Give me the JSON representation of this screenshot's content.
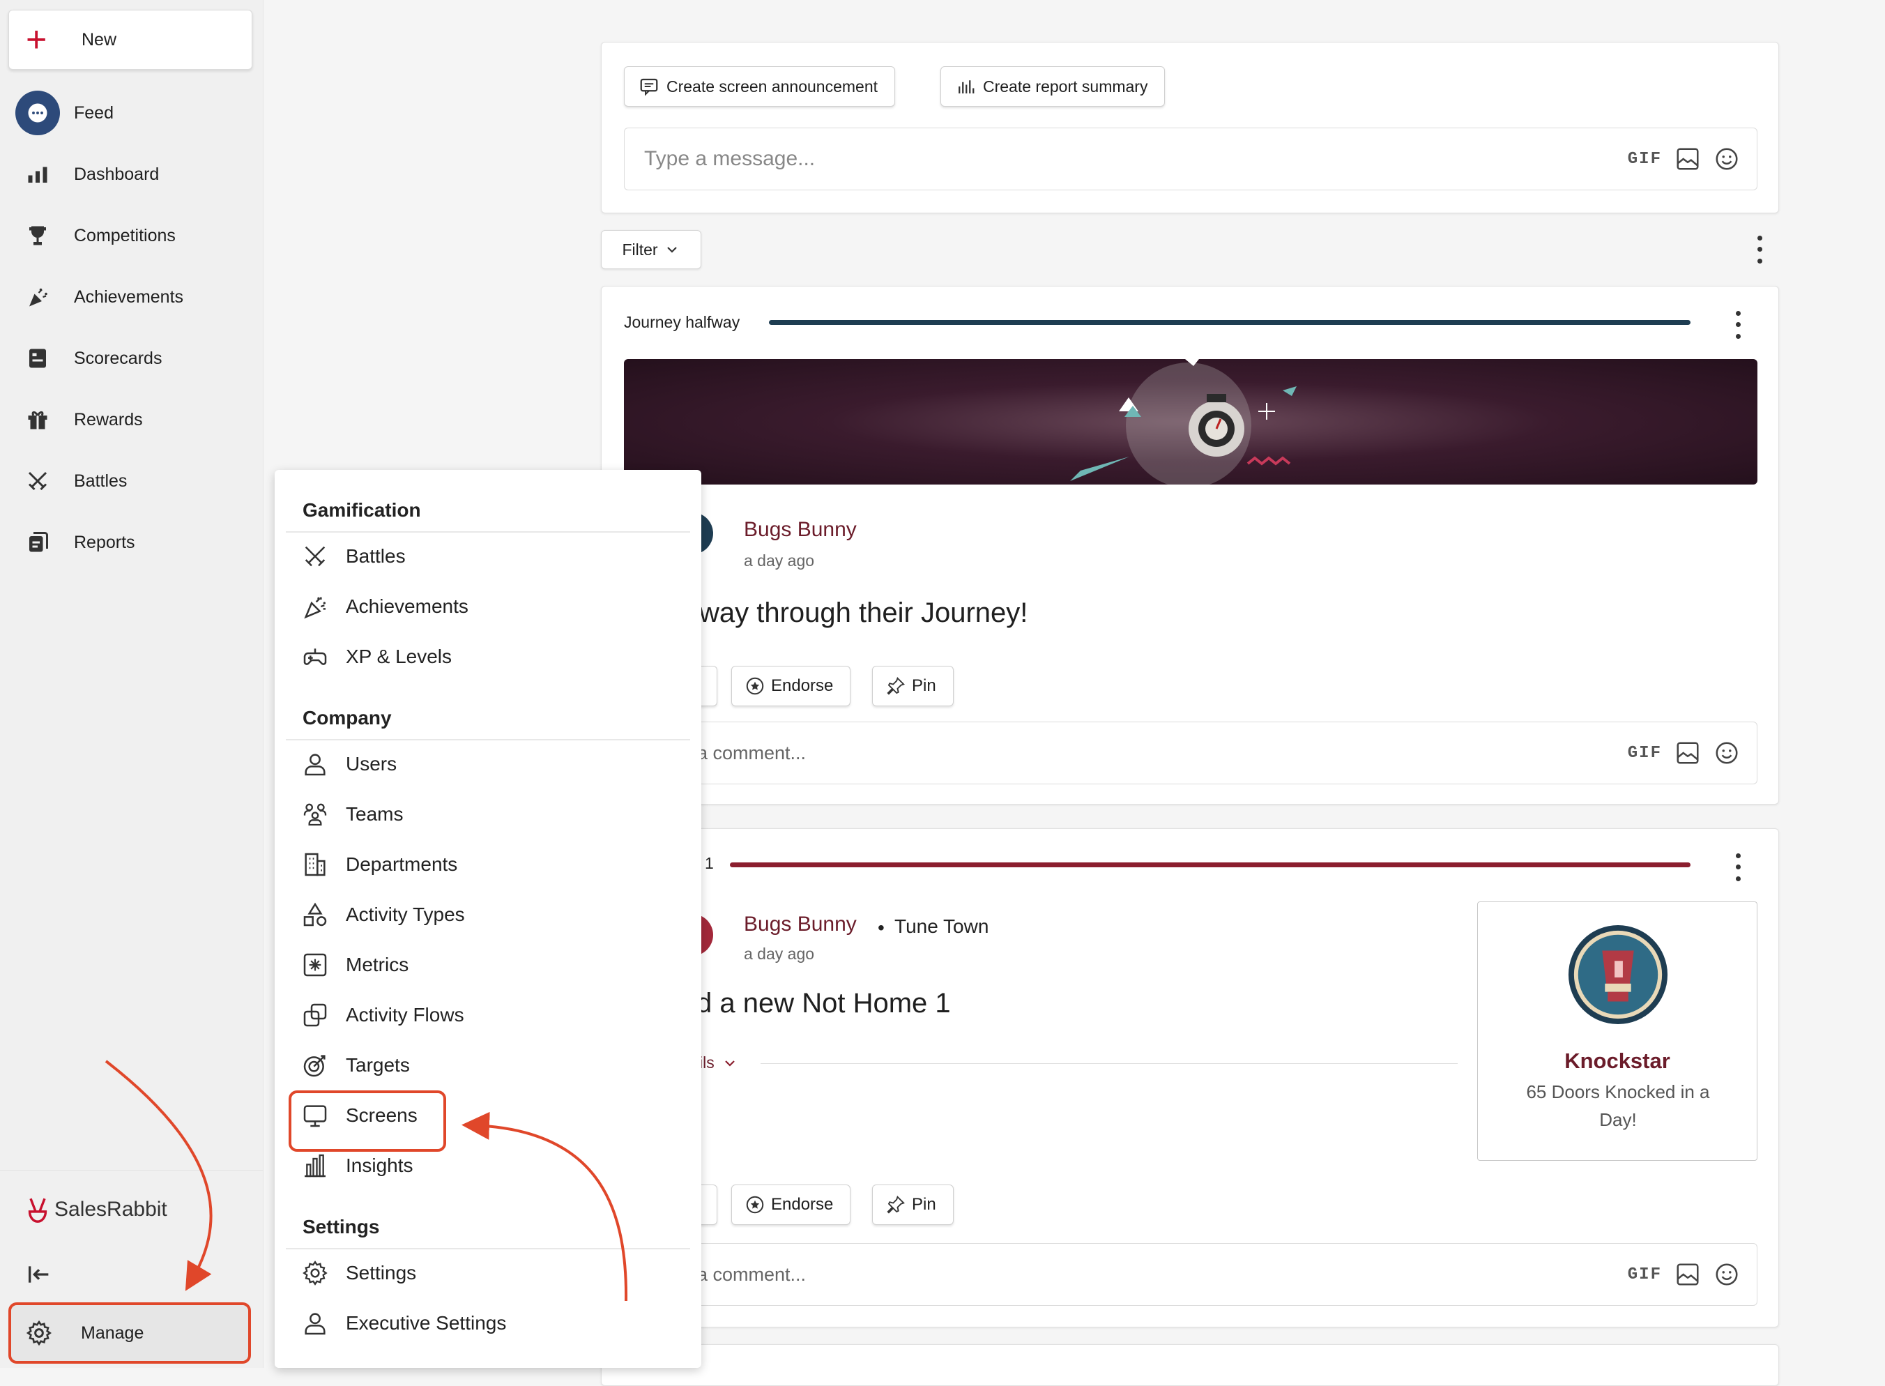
{
  "sidebar": {
    "new_label": "New",
    "items": [
      {
        "label": "Feed",
        "icon": "chat-bubble-icon",
        "active": true
      },
      {
        "label": "Dashboard",
        "icon": "bar-chart-icon"
      },
      {
        "label": "Competitions",
        "icon": "trophy-icon"
      },
      {
        "label": "Achievements",
        "icon": "party-popper-icon"
      },
      {
        "label": "Scorecards",
        "icon": "scorecard-icon"
      },
      {
        "label": "Rewards",
        "icon": "gift-icon"
      },
      {
        "label": "Battles",
        "icon": "crossed-swords-icon"
      },
      {
        "label": "Reports",
        "icon": "reports-icon"
      }
    ],
    "brand": "SalesRabbit",
    "manage_label": "Manage"
  },
  "composer": {
    "announcement_label": "Create screen announcement",
    "report_label": "Create report summary",
    "placeholder": "Type a message...",
    "gif_label": "GIF"
  },
  "feed": {
    "filter_label": "Filter"
  },
  "post1": {
    "progress_label": "Journey halfway",
    "progress_color": "#1e3d52",
    "author": "Bugs Bunny",
    "time": "a day ago",
    "text": "way through their Journey!",
    "endorse_label": "Endorse",
    "pin_label": "Pin",
    "comment_placeholder": "a comment...",
    "gif_label": "GIF"
  },
  "post2": {
    "progress_label": "1",
    "progress_color": "#8b1e2e",
    "author": "Bugs Bunny",
    "location_sep": "•",
    "location": "Tune Town",
    "time": "a day ago",
    "text": "d a new Not Home 1",
    "details_label": "ils",
    "badge_title": "Knockstar",
    "badge_desc": "65 Doors Knocked in a Day!",
    "endorse_label": "Endorse",
    "pin_label": "Pin",
    "comment_placeholder": "a comment...",
    "gif_label": "GIF"
  },
  "manage_menu": {
    "sections": [
      {
        "title": "Gamification",
        "items": [
          "Battles",
          "Achievements",
          "XP & Levels"
        ]
      },
      {
        "title": "Company",
        "items": [
          "Users",
          "Teams",
          "Departments",
          "Activity Types",
          "Metrics",
          "Activity Flows",
          "Targets",
          "Screens",
          "Insights"
        ]
      },
      {
        "title": "Settings",
        "items": [
          "Settings",
          "Executive Settings"
        ]
      }
    ]
  },
  "colors": {
    "accent_red": "#c8102e",
    "highlight": "#e0472a",
    "author": "#6b1c2a"
  }
}
